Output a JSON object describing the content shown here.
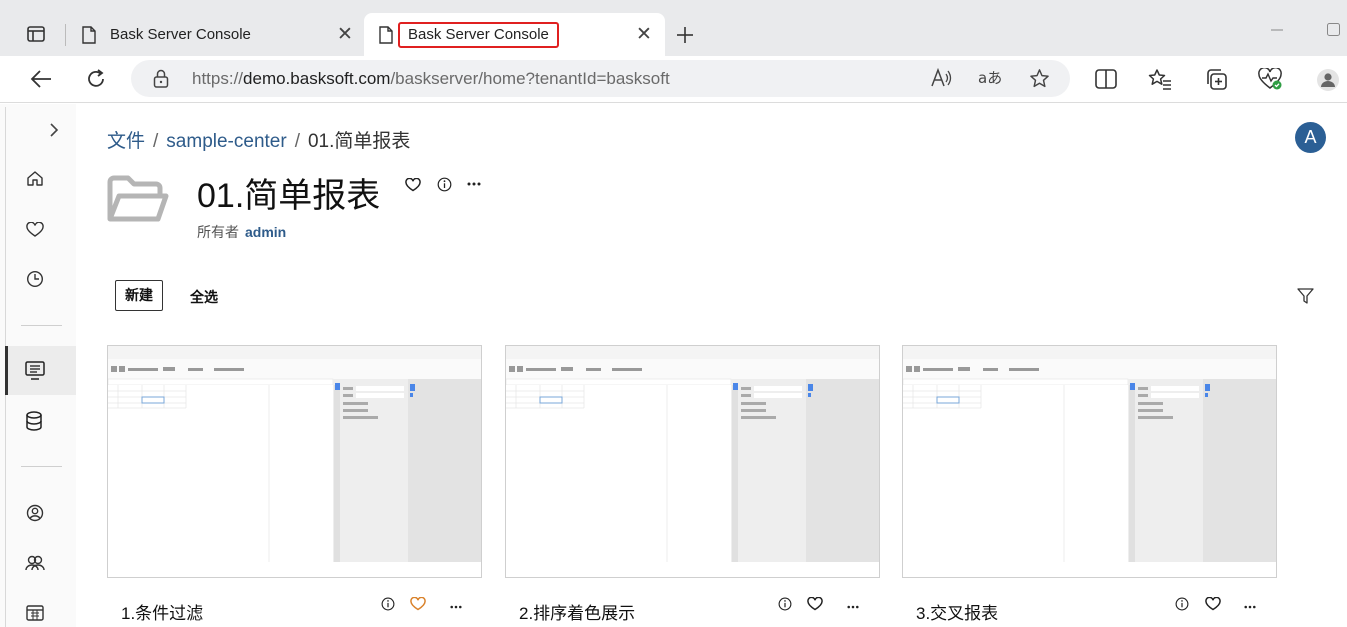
{
  "browser": {
    "tabs": [
      {
        "title": "Bask Server Console"
      },
      {
        "title": "Bask Server Console"
      }
    ],
    "url_prefix": "https://",
    "url_host": "demo.basksoft.com",
    "url_path": "/baskserver/home?tenantId=basksoft"
  },
  "breadcrumb": {
    "root": "文件",
    "sep1": "/",
    "middle": "sample-center",
    "sep2": "/",
    "current": "01.简单报表"
  },
  "user": {
    "avatar_letter": "A"
  },
  "folder": {
    "title": "01.简单报表",
    "owner_label": "所有者",
    "owner_name": "admin"
  },
  "toolbar": {
    "new_label": "新建",
    "select_all_label": "全选"
  },
  "cards": [
    {
      "name": "1.条件过滤",
      "favorited": true
    },
    {
      "name": "2.排序着色展示",
      "favorited": false
    },
    {
      "name": "3.交叉报表",
      "favorited": false
    }
  ],
  "colors": {
    "accent": "#2e5b8a",
    "favorite": "#d9822b",
    "highlight_box": "#e02020"
  }
}
